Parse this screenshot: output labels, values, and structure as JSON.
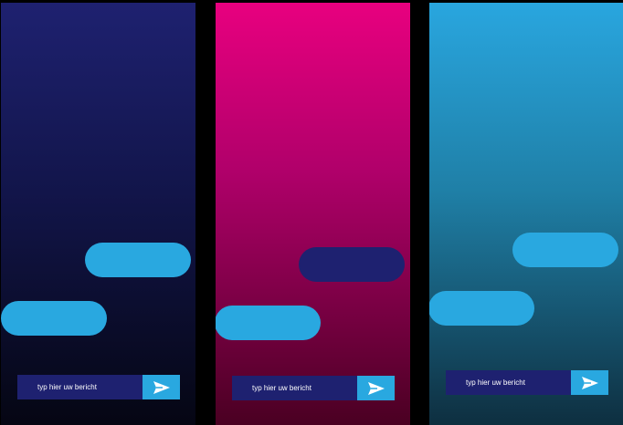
{
  "colors": {
    "background": "#000000",
    "navy": "#1e2170",
    "magenta": "#e8007f",
    "sky_blue": "#29a8e0"
  },
  "panels": [
    {
      "composer": {
        "placeholder": "typ hier uw bericht",
        "send_icon": "send-icon"
      },
      "bubbles": [
        {
          "side": "right",
          "color": "#29a8e0",
          "text": ""
        },
        {
          "side": "left",
          "color": "#29a8e0",
          "text": ""
        }
      ]
    },
    {
      "composer": {
        "placeholder": "typ hier uw bericht",
        "send_icon": "send-icon"
      },
      "bubbles": [
        {
          "side": "right",
          "color": "#1e2170",
          "text": ""
        },
        {
          "side": "left",
          "color": "#29a8e0",
          "text": ""
        }
      ]
    },
    {
      "composer": {
        "placeholder": "typ hier uw bericht",
        "send_icon": "send-icon"
      },
      "bubbles": [
        {
          "side": "right",
          "color": "#29a8e0",
          "text": ""
        },
        {
          "side": "left",
          "color": "#29a8e0",
          "text": ""
        }
      ]
    }
  ]
}
